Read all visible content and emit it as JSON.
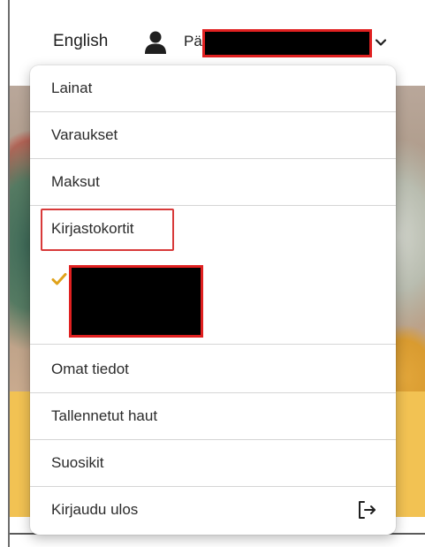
{
  "header": {
    "language_label": "English",
    "user_name_visible": "Pä",
    "user_icon": "user-icon",
    "chevron_icon": "chevron-down-icon"
  },
  "menu": {
    "items": [
      {
        "label": "Lainat"
      },
      {
        "label": "Varaukset"
      },
      {
        "label": "Maksut"
      },
      {
        "label": "Kirjastokortit"
      }
    ],
    "library_card_selected_icon": "checkmark-icon",
    "items_after": [
      {
        "label": "Omat tiedot"
      },
      {
        "label": "Tallennetut haut"
      },
      {
        "label": "Suosikit"
      },
      {
        "label": "Kirjaudu ulos",
        "icon": "logout-icon"
      }
    ]
  },
  "colors": {
    "accent_check": "#e0a21a",
    "redaction_border": "#e02020",
    "highlight_border": "#d83a3a",
    "band": "#f2c253"
  }
}
